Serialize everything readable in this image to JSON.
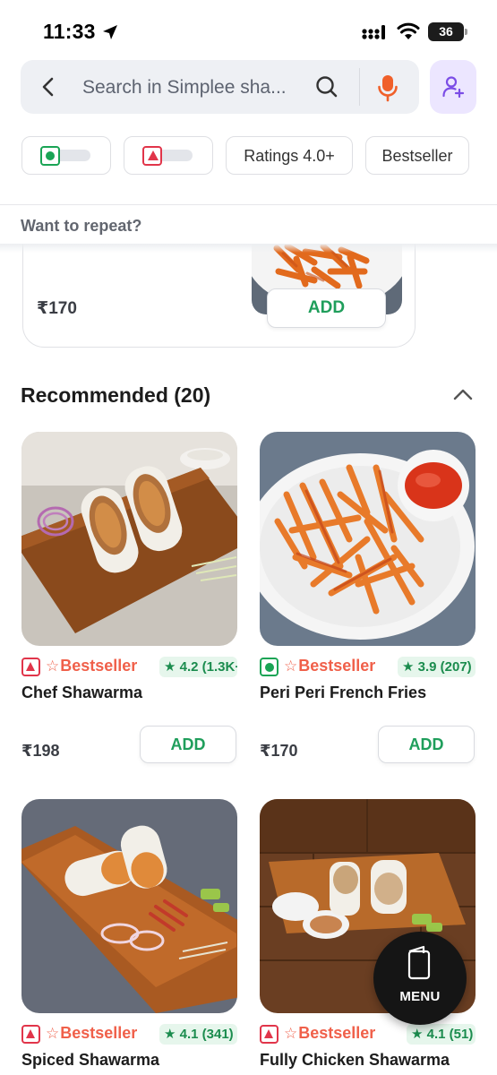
{
  "status_bar": {
    "time": "11:33",
    "battery": "36"
  },
  "search": {
    "placeholder": "Search in Simplee sha..."
  },
  "filters": {
    "veg_toggle": "veg-filter",
    "nonveg_toggle": "nonveg-filter",
    "ratings": "Ratings 4.0+",
    "bestseller": "Bestseller"
  },
  "repeat": {
    "title": "Want to repeat?",
    "item_price": "₹170",
    "add_label": "ADD"
  },
  "recommended": {
    "title": "Recommended (20)",
    "items": [
      {
        "name": "Chef Shawarma",
        "type": "nonveg",
        "tag": "Bestseller",
        "rating": "4.2 (1.3K+",
        "price": "₹198",
        "add_label": "ADD"
      },
      {
        "name": "Peri Peri French Fries",
        "type": "veg",
        "tag": "Bestseller",
        "rating": "3.9 (207)",
        "price": "₹170",
        "add_label": "ADD"
      },
      {
        "name": "Spiced Shawarma",
        "type": "nonveg",
        "tag": "Bestseller",
        "rating": "4.1 (341)"
      },
      {
        "name": "Fully Chicken Shawarma",
        "type": "nonveg",
        "tag": "Bestseller",
        "rating": "4.1 (51)"
      }
    ]
  },
  "menu_button": {
    "label": "MENU"
  },
  "colors": {
    "accent_green": "#1f9e5b",
    "bestseller": "#f0604a",
    "nonveg": "#e1354a",
    "veg": "#1aa455",
    "mic": "#f0602a",
    "profile_bg": "#ece6ff"
  },
  "icons": [
    "back-icon",
    "search-icon",
    "mic-icon",
    "add-person-icon",
    "chevron-up-icon",
    "menu-book-icon",
    "location-arrow-icon",
    "wifi-icon",
    "signal-icon"
  ]
}
